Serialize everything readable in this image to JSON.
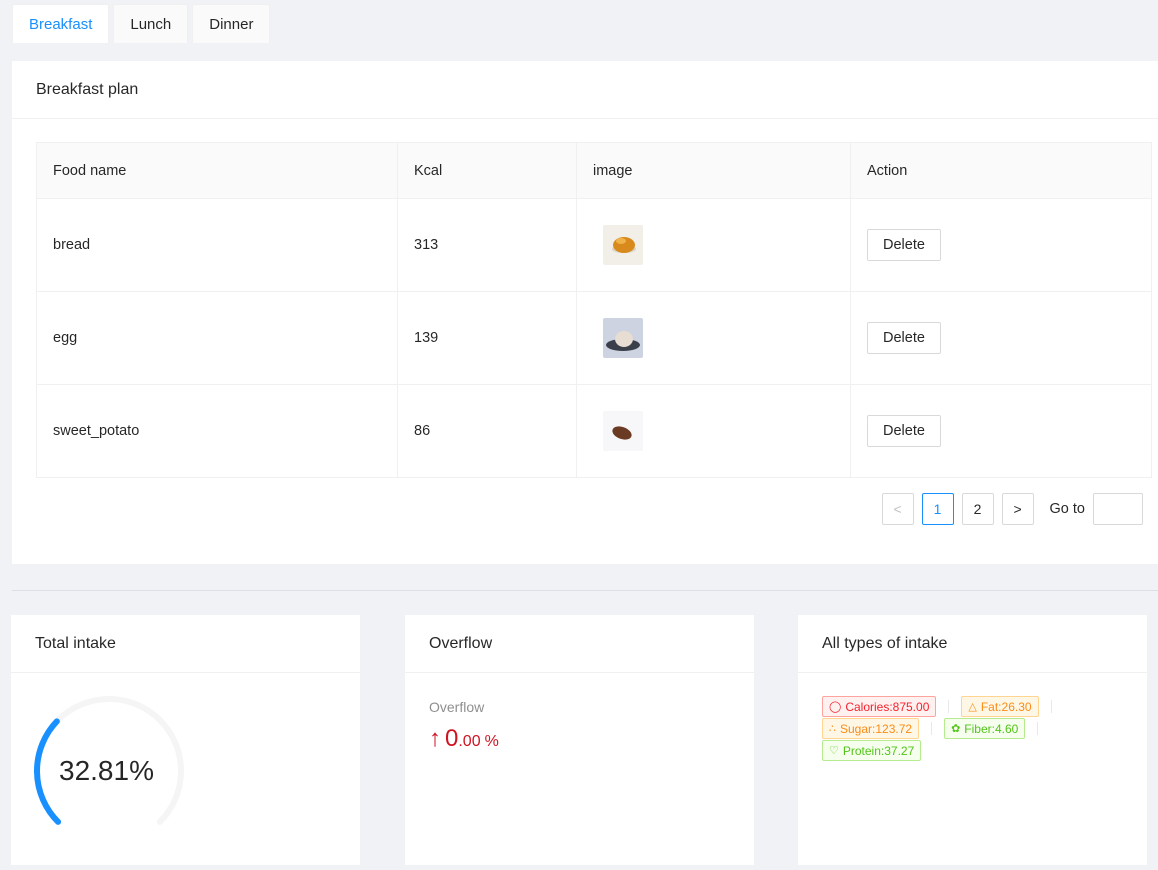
{
  "tabs": [
    {
      "label": "Breakfast",
      "active": true
    },
    {
      "label": "Lunch",
      "active": false
    },
    {
      "label": "Dinner",
      "active": false
    }
  ],
  "plan": {
    "title": "Breakfast plan",
    "columns": [
      "Food name",
      "Kcal",
      "image",
      "Action"
    ],
    "rows": [
      {
        "name": "bread",
        "kcal": "313",
        "image": "bread-photo",
        "action": "Delete"
      },
      {
        "name": "egg",
        "kcal": "139",
        "image": "egg-photo",
        "action": "Delete"
      },
      {
        "name": "sweet_potato",
        "kcal": "86",
        "image": "sweet-potato-photo",
        "action": "Delete"
      }
    ],
    "pagination": {
      "prev": "<",
      "pages": [
        "1",
        "2"
      ],
      "current": "1",
      "next": ">",
      "goto_label": "Go to"
    }
  },
  "total_intake": {
    "title": "Total intake",
    "percent_text": "32.81%",
    "percent": 32.81,
    "color": "#1890ff"
  },
  "overflow": {
    "title": "Overflow",
    "stat_title": "Overflow",
    "arrow": "↑",
    "int": "0",
    "dec": ".00",
    "suffix": "%",
    "color": "#cf1322"
  },
  "intake_types": {
    "title": "All types of intake",
    "tags": [
      {
        "label": "Calories:875.00",
        "icon": "fire-icon",
        "color": "red"
      },
      {
        "label": "Fat:26.30",
        "icon": "warning-icon",
        "color": "orange"
      },
      {
        "label": "Sugar:123.72",
        "icon": "cluster-icon",
        "color": "orange"
      },
      {
        "label": "Fiber:4.60",
        "icon": "leaf-icon",
        "color": "green"
      },
      {
        "label": "Protein:37.27",
        "icon": "heart-icon",
        "color": "green"
      }
    ]
  }
}
